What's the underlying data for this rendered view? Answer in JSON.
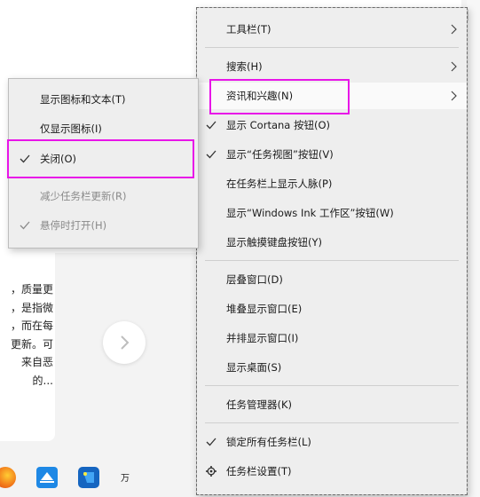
{
  "background": {
    "snippet_lines": [
      "，质量更",
      "，是指微",
      "，而在每",
      "更新。可",
      "来自恶",
      "的..."
    ]
  },
  "taskbar": {
    "ime_label": "万"
  },
  "main_menu": {
    "items": [
      {
        "label": "工具栏(T)"
      },
      {
        "label": "搜索(H)"
      },
      {
        "label": "资讯和兴趣(N)"
      },
      {
        "label": "显示 Cortana 按钮(O)"
      },
      {
        "label": "显示“任务视图”按钮(V)"
      },
      {
        "label": "在任务栏上显示人脉(P)"
      },
      {
        "label": "显示“Windows Ink 工作区”按钮(W)"
      },
      {
        "label": "显示触摸键盘按钮(Y)"
      },
      {
        "label": "层叠窗口(D)"
      },
      {
        "label": "堆叠显示窗口(E)"
      },
      {
        "label": "并排显示窗口(I)"
      },
      {
        "label": "显示桌面(S)"
      },
      {
        "label": "任务管理器(K)"
      },
      {
        "label": "锁定所有任务栏(L)"
      },
      {
        "label": "任务栏设置(T)"
      }
    ]
  },
  "sub_menu": {
    "items": [
      {
        "label": "显示图标和文本(T)"
      },
      {
        "label": "仅显示图标(I)"
      },
      {
        "label": "关闭(O)"
      },
      {
        "label": "减少任务栏更新(R)"
      },
      {
        "label": "悬停时打开(H)"
      }
    ]
  },
  "colors": {
    "highlight_box": "#e815e8",
    "menu_bg": "#eeeeee",
    "disabled_text": "#8a8a8a"
  }
}
